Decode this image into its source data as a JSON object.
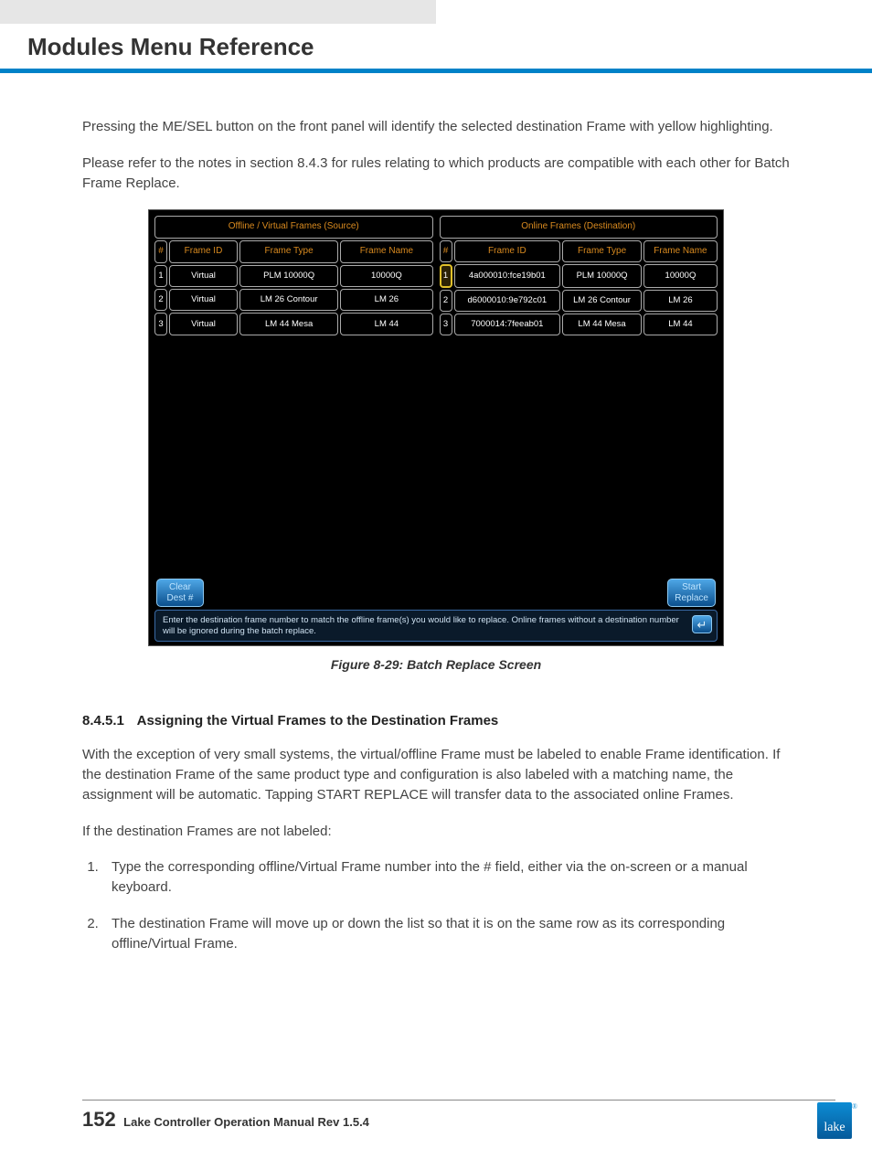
{
  "header": {
    "title": "Modules Menu Reference"
  },
  "body": {
    "p1": "Pressing the ME/SEL button on the front panel will identify the selected destination Frame with yellow highlighting.",
    "p2": "Please refer to the notes in section 8.4.3 for rules relating to which products are compatible with each other for Batch Frame Replace."
  },
  "figure": {
    "caption": "Figure 8-29: Batch Replace Screen",
    "left_title": "Offline / Virtual Frames (Source)",
    "right_title": "Online Frames (Destination)",
    "columns": {
      "num": "#",
      "id": "Frame ID",
      "type": "Frame Type",
      "name": "Frame Name"
    },
    "left_rows": [
      {
        "n": "1",
        "id": "Virtual",
        "type": "PLM 10000Q",
        "name": "10000Q"
      },
      {
        "n": "2",
        "id": "Virtual",
        "type": "LM 26 Contour",
        "name": "LM 26"
      },
      {
        "n": "3",
        "id": "Virtual",
        "type": "LM 44 Mesa",
        "name": "LM 44"
      }
    ],
    "right_rows": [
      {
        "n": "1",
        "id": "4a000010:fce19b01",
        "type": "PLM 10000Q",
        "name": "10000Q",
        "selected": true
      },
      {
        "n": "2",
        "id": "d6000010:9e792c01",
        "type": "LM 26 Contour",
        "name": "LM 26"
      },
      {
        "n": "3",
        "id": "7000014:7feeab01",
        "type": "LM 44 Mesa",
        "name": "LM 44"
      }
    ],
    "buttons": {
      "clear": "Clear\nDest #",
      "start": "Start\nReplace"
    },
    "help": "Enter the destination frame number to match the offline frame(s) you would like to replace. Online frames without a destination number will be ignored during the batch replace."
  },
  "section": {
    "num": "8.4.5.1",
    "title": "Assigning the Virtual Frames to the Destination Frames",
    "p1": "With the exception of very small systems, the virtual/offline Frame must be labeled to enable Frame identification. If the destination Frame of the same product type and configuration is also labeled with a matching name, the assignment will be automatic. Tapping START REPLACE will transfer data to the associated online Frames.",
    "p2": "If the destination Frames are not labeled:",
    "steps": [
      "Type the corresponding offline/Virtual Frame number into the # field, either via the on-screen or a manual keyboard.",
      "The destination Frame will move up or down the list so that it is on the same row as its corresponding offline/Virtual Frame."
    ]
  },
  "footer": {
    "page": "152",
    "title": "Lake Controller Operation Manual Rev 1.5.4",
    "logo": "lake"
  }
}
